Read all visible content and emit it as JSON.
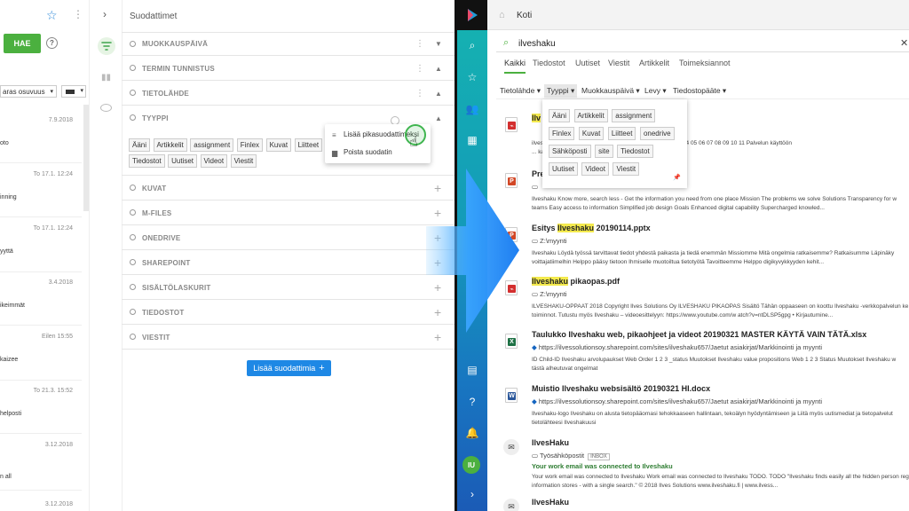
{
  "left": {
    "hae_label": "HAE",
    "sort_value": "aras osuvuus",
    "dates": [
      "7.9.2018",
      "To 17.1. 12:24",
      "To 17.1. 12:24",
      "3.4.2018",
      "Eilen 15:55",
      "To 21.3. 15:52",
      "3.12.2018",
      "3.12.2018"
    ],
    "snips": [
      "oto",
      "inning",
      "yyttä",
      "ikeimmät",
      "kaizee",
      "helposti",
      "n all"
    ]
  },
  "filters": {
    "title": "Suodattimet",
    "rows": [
      {
        "label": "MUOKKAUSPÄIVÄ"
      },
      {
        "label": "TERMIN TUNNISTUS"
      },
      {
        "label": "TIETOLÄHDE"
      },
      {
        "label": "TYYPPI"
      },
      {
        "label": "KUVAT"
      },
      {
        "label": "M-FILES"
      },
      {
        "label": "ONEDRIVE"
      },
      {
        "label": "SHAREPOINT"
      },
      {
        "label": "SISÄLTÖLASKURIT"
      },
      {
        "label": "TIEDOSTOT"
      },
      {
        "label": "VIESTIT"
      }
    ],
    "type_tags": [
      "Ääni",
      "Artikkelit",
      "assignment",
      "Finlex",
      "Kuvat",
      "Liitteet",
      "Tiedostot",
      "Uutiset",
      "Videot",
      "Viestit"
    ],
    "context_menu": {
      "add_quick": "Lisää pikasuodattimeksi",
      "remove": "Poista suodatin"
    },
    "add_button": "Lisää suodattimia"
  },
  "app": {
    "home": "Koti",
    "search_value": "ilveshaku",
    "tabs": [
      "Kaikki",
      "Tiedostot",
      "Uutiset",
      "Viestit",
      "Artikkelit",
      "Toimeksiannot"
    ],
    "refiners": [
      "Tietolähde",
      "Tyyppi",
      "Muokkauspäivä",
      "Levy",
      "Tiedostopääte"
    ],
    "dropdown_tags": [
      "Ääni",
      "Artikkelit",
      "assignment",
      "Finlex",
      "Kuvat",
      "Liitteet",
      "onedrive",
      "Sähköposti",
      "site",
      "Tiedostot",
      "Uutiset",
      "Videot",
      "Viestit"
    ],
    "avatar": "IU",
    "results": [
      {
        "title_pre": "",
        "title_hl": "Ilv",
        "title_post": "",
        "loc": "",
        "snip1": "ilveshaku ... Ilveshaku © Ilveshaku ohjeet 2018 Sisällys 03 04 05 06 07 08 09 10 11 Palvelun käyttöön",
        "snip2": "... kansiossa Dokumentin lataaminen omalle koneell..."
      },
      {
        "title_pre": "Pre",
        "title_hl": "",
        "title_post": "",
        "loc": "",
        "snip1": "Ilveshaku Know more, search less - Get the information you need from one place Mission The problems we solve Solutions Transparency for w",
        "snip2": "teams Easy access to information Simplified job design Goals Enhanced digital capability Supercharged knowled..."
      },
      {
        "title_pre": "Esitys ",
        "title_hl": "Ilveshaku",
        "title_post": " 20190114.pptx",
        "loc": "Z:\\myynti",
        "snip1": "Ilveshaku Löydä työssä tarvittavat tiedot yhdestä paikasta ja tiedä enemmän Missiomme Mitä ongelmia ratkaisemme? Ratkaisumme Läpinäky",
        "snip2": "voittajatiimelhin Helppo pääsy tietoon Ihmiselle muotoiltua tietotyötä Tavoitteemme Helppo digikyvykkyyden kehit..."
      },
      {
        "title_pre": "",
        "title_hl": "Ilveshaku",
        "title_post": " pikaopas.pdf",
        "loc": "Z:\\myynti",
        "snip1": "ILVESHAKU-OPPAAT 2018 Copyright Ilves Solutions Oy ILVESHAKU PIKAOPAS Sisältö Tähän oppaaseen on koottu Ilveshaku -verkkopalvelun ke",
        "snip2": "toiminnot. Tutustu myös Ilveshaku – videoesittelyyn: https://www.youtube.com/w atch?v=ntDLSP5gpg • Kirjautumine..."
      },
      {
        "title_pre": "Taulukko Ilveshaku web, pikaohjeet ja videot 20190321 MASTER KÄYTÄ VAIN TÄTÄ.xlsx",
        "title_hl": "",
        "title_post": "",
        "loc": "https://ilvessolutionsoy.sharepoint.com/sites/ilveshaku657/Jaetut asiakirjat/Markkinointi ja myynti",
        "snip1": "ID Child-ID Ilveshaku arvolupaukset Web Order 1 2 3 _status Muutokset Ilveshaku value propositions Web 1 2 3 Status Muutokset Ilveshaku w",
        "snip2": "tästä alheutuvat ongelmat"
      },
      {
        "title_pre": "Muistio Ilveshaku websisältö 20190321 HI.docx",
        "title_hl": "",
        "title_post": "",
        "loc": "https://ilvessolutionsoy.sharepoint.com/sites/ilveshaku657/Jaetut asiakirjat/Markkinointi ja myynti",
        "snip1": "Ilveshaku-logo Ilveshaku on alusta tietopääomasi tehokkaaseen hallintaan, tekoälyn hyödyntämiseen ja Liitä myös uutismediat ja tietopalvelut",
        "snip2": "tietolähteesi Ilveshakuusi"
      },
      {
        "title_pre": "IlvesHaku",
        "title_hl": "",
        "title_post": "",
        "loc": "Työsähköpostit",
        "inbox": "INBOX",
        "subject": "Your work email was connected to Ilveshaku",
        "snip1": "Your work email was connected to Ilveshaku Work email was connected to Ilveshaku TODO. TODO \"Ilveshaku finds easily all the hidden person registers fro",
        "snip2": "information stores - with a single search.\" © 2018 Ilves Solutions www.ilveshaku.fi | www.ilvess..."
      },
      {
        "title_pre": "IlvesHaku",
        "title_hl": "",
        "title_post": "",
        "loc": "",
        "snip1": "",
        "snip2": ""
      }
    ]
  },
  "colors": {
    "accent_green": "#4bb03f",
    "blue_button": "#1e88e5",
    "highlight": "#f4ea4d"
  }
}
